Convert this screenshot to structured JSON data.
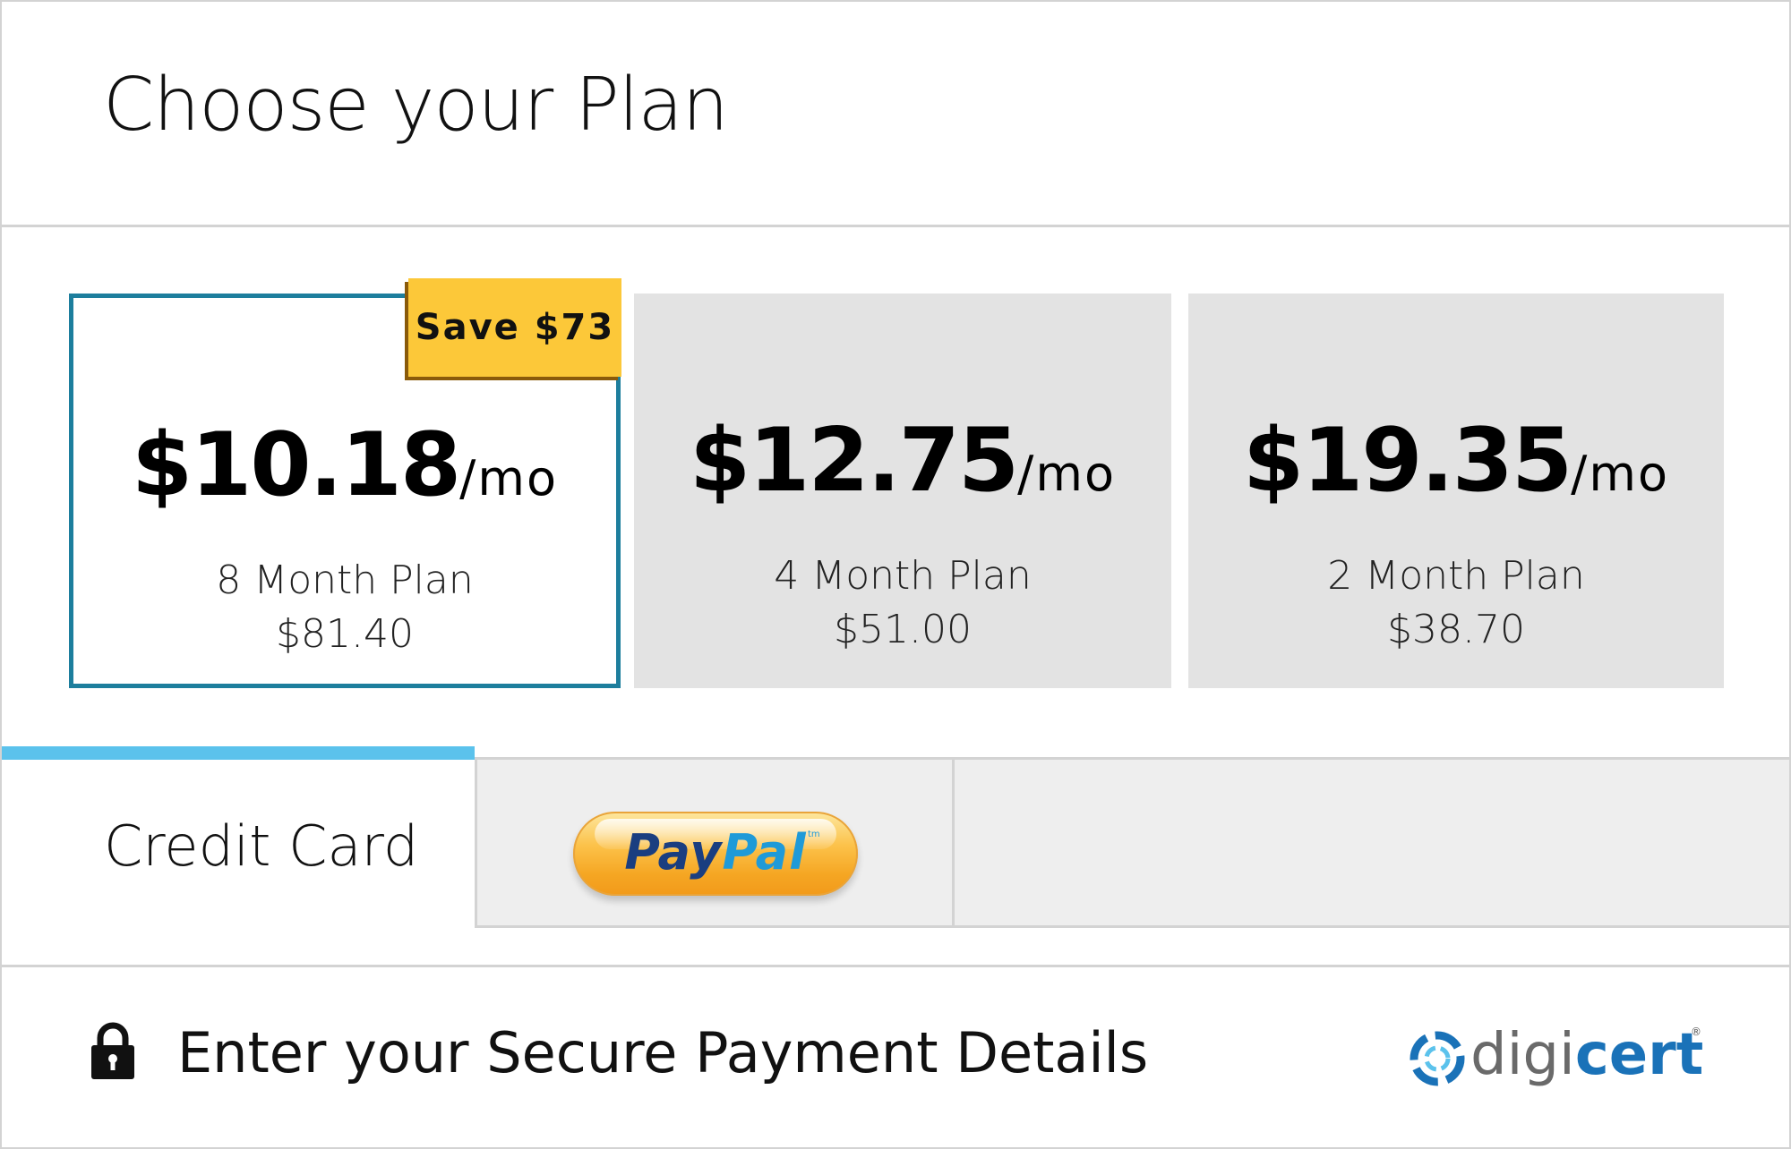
{
  "header": {
    "title": "Choose your Plan"
  },
  "plans": [
    {
      "price": "$10.18",
      "unit": "/mo",
      "name": "8 Month Plan",
      "total": "$81.40",
      "selected": true
    },
    {
      "price": "$12.75",
      "unit": "/mo",
      "name": "4 Month Plan",
      "total": "$51.00",
      "selected": false
    },
    {
      "price": "$19.35",
      "unit": "/mo",
      "name": "2 Month Plan",
      "total": "$38.70",
      "selected": false
    }
  ],
  "badge": {
    "label": "Save $73"
  },
  "payment_tabs": {
    "credit_card_label": "Credit Card",
    "paypal_label_part1": "Pay",
    "paypal_label_part2": "Pal",
    "paypal_tm": "tm",
    "active": "Credit Card"
  },
  "footer": {
    "text": "Enter your Secure Payment Details",
    "logo_part1": "digi",
    "logo_part2": "cert",
    "logo_reg": "®"
  },
  "colors": {
    "selected_border": "#1d7e9d",
    "badge": "#fcc839",
    "tab_accent": "#5bc2ec",
    "unselected_plan_bg": "#e3e3e3",
    "brand_blue": "#1a72b8"
  },
  "icons": {
    "lock": "lock-icon",
    "logo_mark": "digicert-swirl-icon"
  }
}
